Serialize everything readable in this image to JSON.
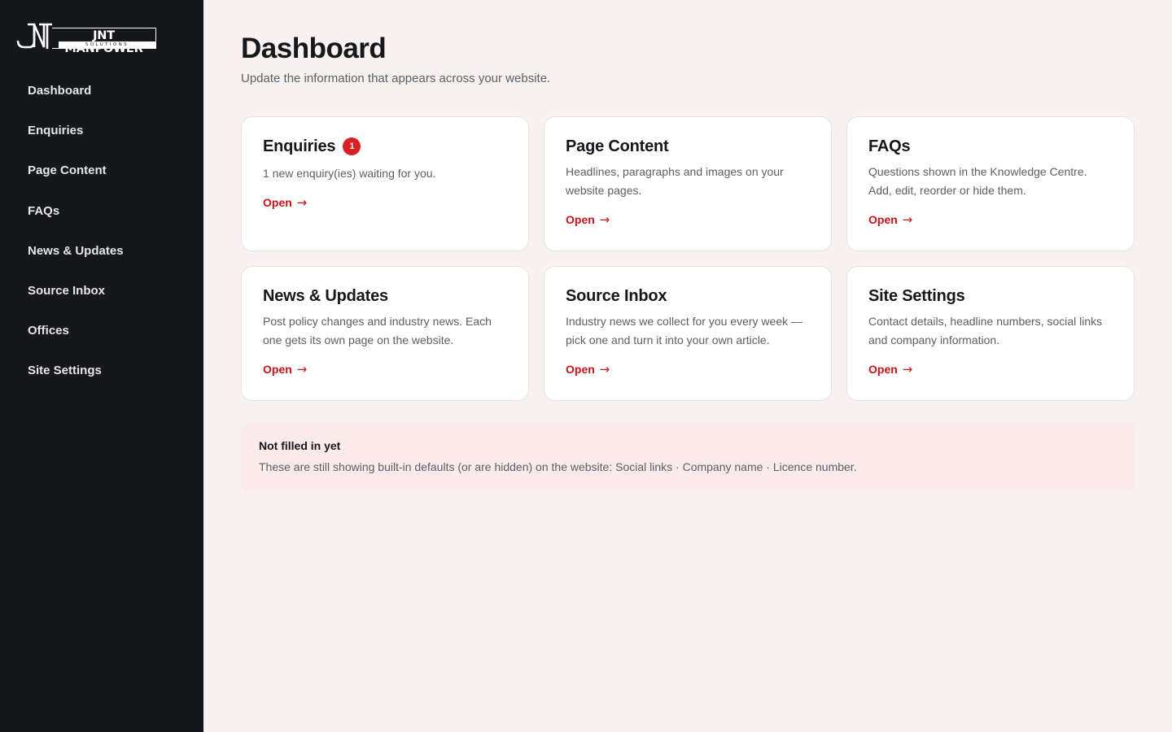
{
  "brand": {
    "name": "JNT MANPOWER",
    "tagline": "SOLUTIONS",
    "monogram": "JNT"
  },
  "sidebar": {
    "items": [
      {
        "label": "Dashboard"
      },
      {
        "label": "Enquiries"
      },
      {
        "label": "Page Content"
      },
      {
        "label": "FAQs"
      },
      {
        "label": "News & Updates"
      },
      {
        "label": "Source Inbox"
      },
      {
        "label": "Offices"
      },
      {
        "label": "Site Settings"
      }
    ]
  },
  "header": {
    "title": "Dashboard",
    "subtitle": "Update the information that appears across your website."
  },
  "cards": [
    {
      "title": "Enquiries",
      "badge": "1",
      "description": "1 new enquiry(ies) waiting for you.",
      "link": "Open"
    },
    {
      "title": "Page Content",
      "description": "Headlines, paragraphs and images on your website pages.",
      "link": "Open"
    },
    {
      "title": "FAQs",
      "description": "Questions shown in the Knowledge Centre. Add, edit, reorder or hide them.",
      "link": "Open"
    },
    {
      "title": "News & Updates",
      "description": "Post policy changes and industry news. Each one gets its own page on the website.",
      "link": "Open"
    },
    {
      "title": "Source Inbox",
      "description": "Industry news we collect for you every week — pick one and turn it into your own article.",
      "link": "Open"
    },
    {
      "title": "Site Settings",
      "description": "Contact details, headline numbers, social links and company information.",
      "link": "Open"
    }
  ],
  "notice": {
    "title": "Not filled in yet",
    "text": "These are still showing built-in defaults (or are hidden) on the website: Social links · Company name · Licence number."
  },
  "arrow": "→",
  "colors": {
    "sidebar_bg": "#16171b",
    "page_bg": "#f7f1f1",
    "accent": "#c8141c",
    "badge": "#d91f26",
    "notice_bg": "#fbeaea"
  }
}
